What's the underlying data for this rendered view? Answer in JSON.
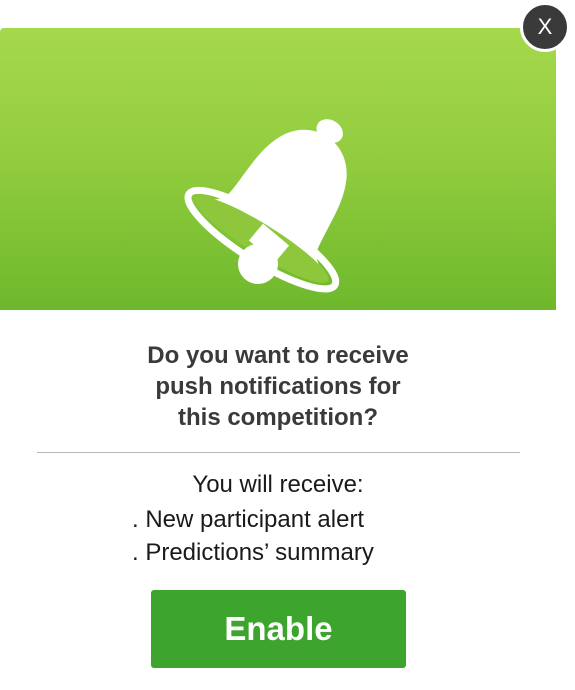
{
  "dialog": {
    "close_label": "X",
    "hero_icon": "bell-icon",
    "hero_colors": {
      "top": "#a6d84d",
      "bottom": "#6eb82c"
    },
    "question_lines": [
      "Do you want to receive",
      "push notifications for",
      "this competition?"
    ],
    "receive_heading": "You will receive:",
    "receive_items": [
      ". New participant alert",
      ". Predictions’ summary"
    ],
    "enable_label": "Enable",
    "enable_color": "#3da52e"
  }
}
